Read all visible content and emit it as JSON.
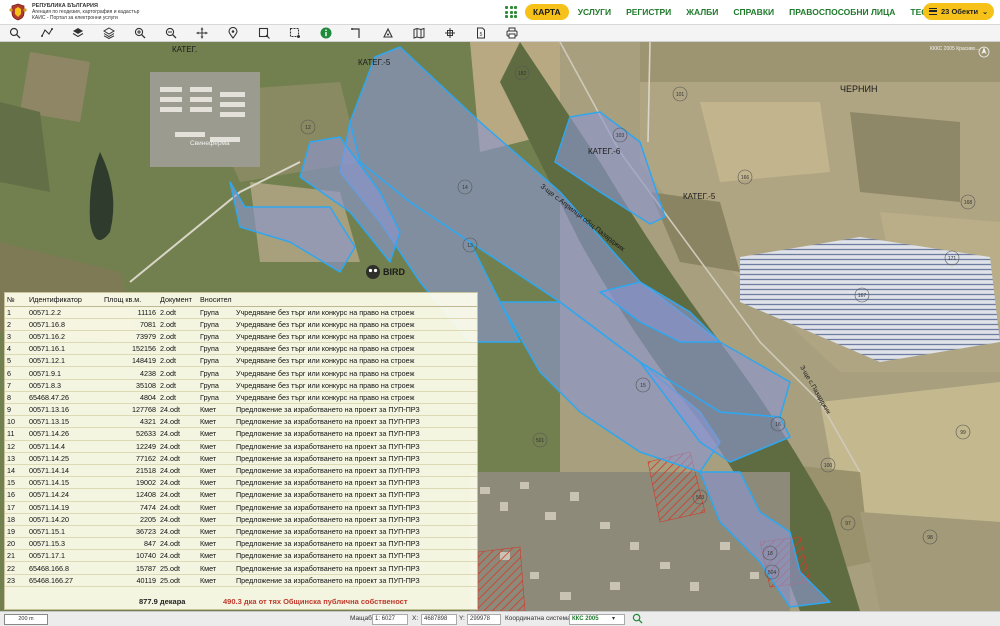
{
  "header": {
    "logo_lines": [
      "РЕПУБЛИКА БЪЛГАРИЯ",
      "Агенция по геодезия, картография и кадастър",
      "КАИС - Портал за електронни услуги"
    ],
    "nav_items": [
      "КАРТА",
      "УСЛУГИ",
      "РЕГИСТРИ",
      "ЖАЛБИ",
      "СПРАВКИ",
      "ПРАВОСПОСОБНИ ЛИЦА",
      "ТЕСТ"
    ],
    "active_nav": "КАРТА",
    "objects_label": "23 Обекти"
  },
  "toolbar": {
    "tools": [
      "search-icon",
      "measure-icon",
      "layers-icon",
      "stack-icon",
      "zoom-in-icon",
      "zoom-out-icon",
      "pan-icon",
      "pin-icon",
      "rectangle-select-icon",
      "polygon-select-icon",
      "info-icon",
      "line-tool-icon",
      "point-tool-icon",
      "map-icon",
      "settings-icon",
      "document-icon",
      "print-icon"
    ],
    "active_tool": "info-icon"
  },
  "map": {
    "labels": {
      "kateg_top": "КАТЕГ.-5",
      "kateg_top2": "КАТЕГ.",
      "kateg_mid": "КАТЕГ.-6",
      "kateg_right": "КАТЕГ.-5",
      "chernin": "ЧЕРНИН",
      "road": "З-ще с.Априлци общ.Пазарджик",
      "road2": "З-ще с.Пазарджик",
      "farm": "Свинеферма",
      "watermark": "BIRD",
      "coord_top": "КККС 2005 Красиво..."
    },
    "parcel_numbers": [
      "182",
      "103",
      "101",
      "14",
      "13",
      "12",
      "11",
      "15",
      "16",
      "17",
      "18",
      "19",
      "20",
      "21",
      "22",
      "47",
      "48",
      "51",
      "60",
      "97",
      "98",
      "99",
      "100",
      "102",
      "166",
      "167",
      "168",
      "171",
      "172",
      "173",
      "174",
      "501",
      "503",
      "504"
    ],
    "colors": {
      "parcel_fill": "#8a96d0",
      "parcel_stroke": "#2fa7ef",
      "hatch": "#d23a2a"
    }
  },
  "parcels_table": {
    "headers": [
      "№",
      "Идентификатор",
      "Площ кв.м.",
      "Документ",
      "Вносител",
      ""
    ],
    "rows": [
      [
        "1",
        "00571.2.2",
        "11116",
        "2.odt",
        "Група",
        "Учредяване без търг или конкурс на право на строеж"
      ],
      [
        "2",
        "00571.16.8",
        "7081",
        "2.odt",
        "Група",
        "Учредяване без търг или конкурс на право на строеж"
      ],
      [
        "3",
        "00571.16.2",
        "73979",
        "2.odt",
        "Група",
        "Учредяване без търг или конкурс на право на строеж"
      ],
      [
        "4",
        "00571.16.1",
        "152156",
        "2.odt",
        "Група",
        "Учредяване без търг или конкурс на право на строеж"
      ],
      [
        "5",
        "00571.12.1",
        "148419",
        "2.odt",
        "Група",
        "Учредяване без търг или конкурс на право на строеж"
      ],
      [
        "6",
        "00571.9.1",
        "4238",
        "2.odt",
        "Група",
        "Учредяване без търг или конкурс на право на строеж"
      ],
      [
        "7",
        "00571.8.3",
        "35108",
        "2.odt",
        "Група",
        "Учредяване без търг или конкурс на право на строеж"
      ],
      [
        "8",
        "65468.47.26",
        "4804",
        "2.odt",
        "Група",
        "Учредяване без търг или конкурс на право на строеж"
      ],
      [
        "9",
        "00571.13.16",
        "127768",
        "24.odt",
        "Кмет",
        "Предложение за изработването на проект за ПУП-ПРЗ"
      ],
      [
        "10",
        "00571.13.15",
        "4321",
        "24.odt",
        "Кмет",
        "Предложение за изработването на проект за ПУП-ПРЗ"
      ],
      [
        "11",
        "00571.14.26",
        "52633",
        "24.odt",
        "Кмет",
        "Предложение за изработването на проект за ПУП-ПРЗ"
      ],
      [
        "12",
        "00571.14.4",
        "12249",
        "24.odt",
        "Кмет",
        "Предложение за изработването на проект за ПУП-ПРЗ"
      ],
      [
        "13",
        "00571.14.25",
        "77162",
        "24.odt",
        "Кмет",
        "Предложение за изработването на проект за ПУП-ПРЗ"
      ],
      [
        "14",
        "00571.14.14",
        "21518",
        "24.odt",
        "Кмет",
        "Предложение за изработването на проект за ПУП-ПРЗ"
      ],
      [
        "15",
        "00571.14.15",
        "19002",
        "24.odt",
        "Кмет",
        "Предложение за изработването на проект за ПУП-ПРЗ"
      ],
      [
        "16",
        "00571.14.24",
        "12408",
        "24.odt",
        "Кмет",
        "Предложение за изработването на проект за ПУП-ПРЗ"
      ],
      [
        "17",
        "00571.14.19",
        "7474",
        "24.odt",
        "Кмет",
        "Предложение за изработването на проект за ПУП-ПРЗ"
      ],
      [
        "18",
        "00571.14.20",
        "2205",
        "24.odt",
        "Кмет",
        "Предложение за изработването на проект за ПУП-ПРЗ"
      ],
      [
        "19",
        "00571.15.1",
        "36723",
        "24.odt",
        "Кмет",
        "Предложение за изработването на проект за ПУП-ПРЗ"
      ],
      [
        "20",
        "00571.15.3",
        "847",
        "24.odt",
        "Кмет",
        "Предложение за изработването на проект за ПУП-ПРЗ"
      ],
      [
        "21",
        "00571.17.1",
        "10740",
        "24.odt",
        "Кмет",
        "Предложение за изработването на проект за ПУП-ПРЗ"
      ],
      [
        "22",
        "65468.166.8",
        "15787",
        "25.odt",
        "Кмет",
        "Предложение за изработването на проект за ПУП-ПРЗ"
      ],
      [
        "23",
        "65468.166.27",
        "40119",
        "25.odt",
        "Кмет",
        "Предложение за изработването на проект за ПУП-ПРЗ"
      ]
    ],
    "total_area": "877.9 декара",
    "total_note": "490.3 дка от тях Общинска публична собственост"
  },
  "statusbar": {
    "scale": "200 m",
    "scale_label": "Мащаб",
    "scale_value": "1: 6027",
    "x_label": "X:",
    "x_value": "4687898",
    "y_label": "Y:",
    "y_value": "299978",
    "crs_label": "Координатна система:",
    "crs_value": "ККС 2005"
  }
}
